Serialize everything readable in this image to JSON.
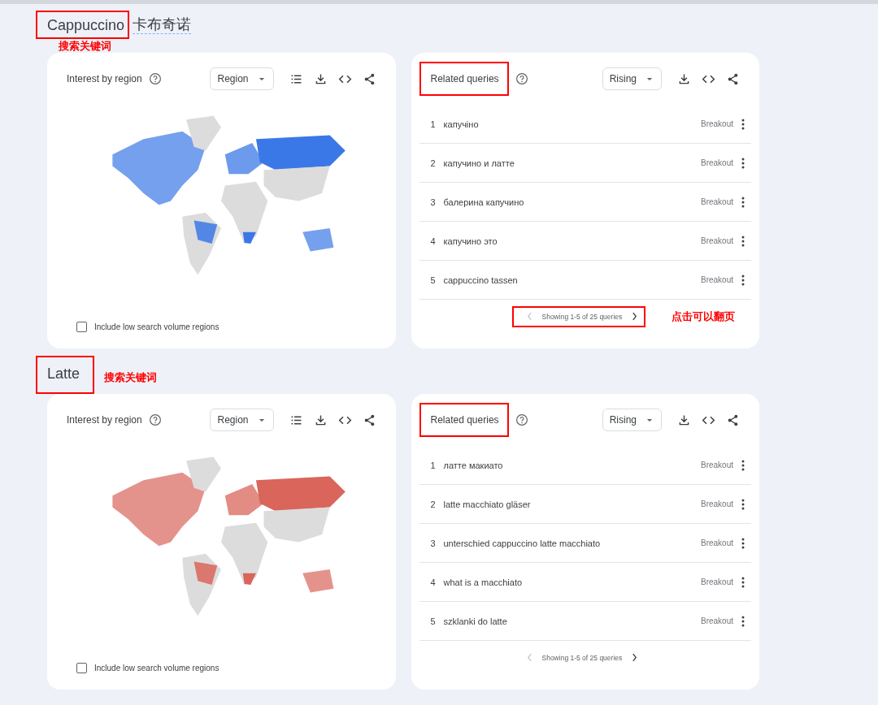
{
  "sections": [
    {
      "keyword": "Cappuccino",
      "keyword_highlighted": true,
      "translation": "卡布奇诺",
      "annotation": "搜索关键词",
      "annotation_beside": false,
      "color": "#3b78e7",
      "region_card": {
        "title": "Interest by region",
        "dropdown": "Region",
        "checkbox_label": "Include low search volume regions",
        "checked": false
      },
      "queries_card": {
        "title": "Related queries",
        "title_highlighted": true,
        "dropdown": "Rising",
        "rows": [
          {
            "rank": "1",
            "query": "капучіно",
            "value": "Breakout"
          },
          {
            "rank": "2",
            "query": "капучино и латте",
            "value": "Breakout"
          },
          {
            "rank": "3",
            "query": "балерина капучино",
            "value": "Breakout"
          },
          {
            "rank": "4",
            "query": "капучино это",
            "value": "Breakout"
          },
          {
            "rank": "5",
            "query": "cappuccino tassen",
            "value": "Breakout"
          }
        ],
        "pagination": "Showing 1-5 of 25 queries",
        "pagination_highlighted": true,
        "pagination_note": "点击可以翻页"
      }
    },
    {
      "keyword": "Latte",
      "keyword_highlighted": true,
      "annotation": "搜索关键词",
      "annotation_beside": true,
      "color": "#d9655b",
      "region_card": {
        "title": "Interest by region",
        "dropdown": "Region",
        "checkbox_label": "Include low search volume regions",
        "checked": false
      },
      "queries_card": {
        "title": "Related queries",
        "title_highlighted": true,
        "dropdown": "Rising",
        "rows": [
          {
            "rank": "1",
            "query": "латте макиато",
            "value": "Breakout"
          },
          {
            "rank": "2",
            "query": "latte macchiato gläser",
            "value": "Breakout"
          },
          {
            "rank": "3",
            "query": "unterschied cappuccino latte macchiato",
            "value": "Breakout"
          },
          {
            "rank": "4",
            "query": "what is a macchiato",
            "value": "Breakout"
          },
          {
            "rank": "5",
            "query": "szklanki do latte",
            "value": "Breakout"
          }
        ],
        "pagination": "Showing 1-5 of 25 queries",
        "pagination_highlighted": false
      }
    }
  ]
}
